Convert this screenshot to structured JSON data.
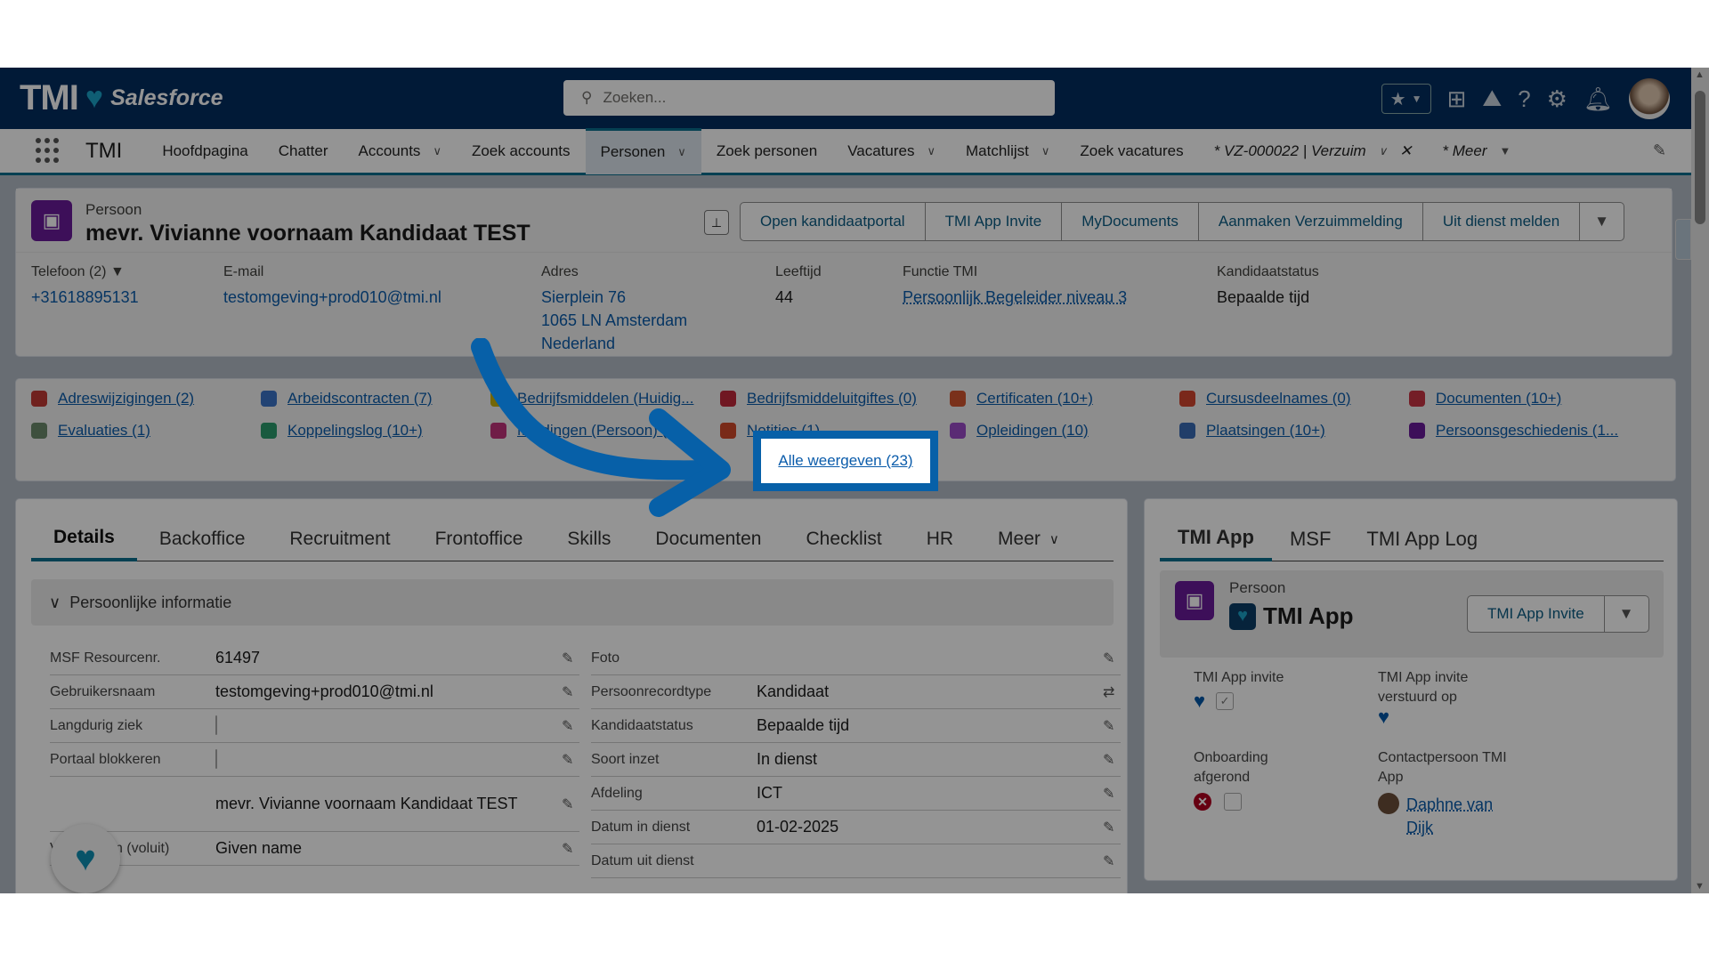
{
  "header": {
    "logo_text": "TMI",
    "logo_sub": "Salesforce",
    "search_placeholder": "Zoeken...",
    "icons": [
      "favorites-star-icon",
      "add-icon",
      "trailhead-icon",
      "help-icon",
      "setup-gear-icon",
      "notification-bell-icon",
      "user-avatar"
    ]
  },
  "nav": {
    "app_name": "TMI",
    "items": [
      {
        "label": "Hoofdpagina",
        "dropdown": false
      },
      {
        "label": "Chatter",
        "dropdown": false
      },
      {
        "label": "Accounts",
        "dropdown": true
      },
      {
        "label": "Zoek accounts",
        "dropdown": false
      },
      {
        "label": "Personen",
        "dropdown": true,
        "active": true
      },
      {
        "label": "Zoek personen",
        "dropdown": false
      },
      {
        "label": "Vacatures",
        "dropdown": true
      },
      {
        "label": "Matchlijst",
        "dropdown": true
      },
      {
        "label": "Zoek vacatures",
        "dropdown": false
      }
    ],
    "open_tab": "* VZ-000022 | Verzuim",
    "more": "* Meer"
  },
  "record": {
    "object": "Persoon",
    "name": "mevr. Vivianne voornaam Kandidaat TEST",
    "actions": [
      "Open kandidaatportal",
      "TMI App Invite",
      "MyDocuments",
      "Aanmaken Verzuimmelding",
      "Uit dienst melden"
    ],
    "fields": {
      "phone_label": "Telefoon (2) ▼",
      "phone": "+31618895131",
      "email_label": "E-mail",
      "email": "testomgeving+prod010@tmi.nl",
      "address_label": "Adres",
      "address": [
        "Sierplein 76",
        "1065 LN Amsterdam",
        "Nederland"
      ],
      "age_label": "Leeftijd",
      "age": "44",
      "function_label": "Functie TMI",
      "function": "Persoonlijk Begeleider niveau 3",
      "status_label": "Kandidaatstatus",
      "status": "Bepaalde tijd"
    }
  },
  "related": {
    "links": [
      {
        "label": "Adreswijzigingen (2)",
        "color": "#c23934"
      },
      {
        "label": "Arbeidscontracten (7)",
        "color": "#3c74c8"
      },
      {
        "label": "Bedrijfsmiddelen (Huidig...",
        "color": "#c9b20d"
      },
      {
        "label": "Bedrijfsmiddeluitgiftes (0)",
        "color": "#c2293b"
      },
      {
        "label": "Certificaten (10+)",
        "color": "#d2552f"
      },
      {
        "label": "Cursusdeelnames (0)",
        "color": "#d2452f"
      },
      {
        "label": "Documenten (10+)",
        "color": "#c93444"
      },
      {
        "label": "Evaluaties (1)",
        "color": "#6b8a6b"
      },
      {
        "label": "Koppelingslog (10+)",
        "color": "#2c9c6d"
      },
      {
        "label": "Meldingen (Persoon) (1)",
        "color": "#c2337a"
      },
      {
        "label": "Notities (1)",
        "color": "#d0492a"
      },
      {
        "label": "Opleidingen (10)",
        "color": "#9c4ac8"
      },
      {
        "label": "Plaatsingen (10+)",
        "color": "#3a6bb5"
      },
      {
        "label": "Persoonsgeschiedenis (1...",
        "color": "#6a1b9a"
      }
    ],
    "view_all": "Alle weergeven (23)"
  },
  "details": {
    "tabs": [
      "Details",
      "Backoffice",
      "Recruitment",
      "Frontoffice",
      "Skills",
      "Documenten",
      "Checklist",
      "HR"
    ],
    "more_tab": "Meer",
    "section": "Persoonlijke informatie",
    "left_fields": [
      {
        "label": "MSF Resourcenr.",
        "value": "61497"
      },
      {
        "label": "Gebruikersnaam",
        "value": "testomgeving+prod010@tmi.nl"
      },
      {
        "label": "Langdurig ziek",
        "checkbox": false
      },
      {
        "label": "Portaal blokkeren",
        "checkbox": false
      },
      {
        "label": "",
        "value": "mevr. Vivianne voornaam Kandidaat TEST"
      },
      {
        "label": "Voornamen (voluit)",
        "value": "Given name"
      }
    ],
    "right_fields": [
      {
        "label": "Foto",
        "value": ""
      },
      {
        "label": "Persoonrecordtype",
        "value": "Kandidaat"
      },
      {
        "label": "Kandidaatstatus",
        "value": "Bepaalde tijd"
      },
      {
        "label": "Soort inzet",
        "value": "In dienst"
      },
      {
        "label": "Afdeling",
        "value": "ICT"
      },
      {
        "label": "Datum in dienst",
        "value": "01-02-2025"
      },
      {
        "label": "Datum uit dienst",
        "value": ""
      }
    ]
  },
  "app_panel": {
    "tabs": [
      "TMI App",
      "MSF",
      "TMI App Log"
    ],
    "object": "Persoon",
    "title": "TMI App",
    "action": "TMI App Invite",
    "invite_label": "TMI App invite",
    "invite_checked": true,
    "sent_label": "TMI App invite verstuurd op",
    "onboarding_label": "Onboarding afgerond",
    "onboarding_checked": false,
    "contact_label": "Contactpersoon TMI App",
    "contact": "Daphne van Dijk"
  },
  "colors": {
    "header": "#032d60",
    "accent": "#0b6e8e",
    "link": "#0b5cab",
    "callout": "#0760a8"
  }
}
